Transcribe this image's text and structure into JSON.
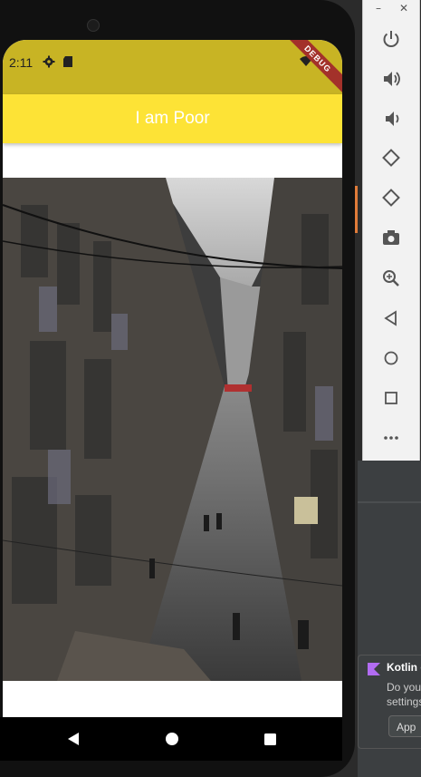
{
  "status_bar": {
    "time": "2:11"
  },
  "app_bar": {
    "title": "I am Poor"
  },
  "debug_banner": "DEBUG",
  "emulator_toolbar": {
    "buttons": [
      "power-icon",
      "volume-up-icon",
      "volume-down-icon",
      "rotate-left-icon",
      "rotate-right-icon",
      "camera-icon",
      "zoom-icon",
      "back-icon",
      "home-icon",
      "overview-icon",
      "more-icon"
    ]
  },
  "notification": {
    "title": "Kotlin c",
    "line1": "Do you",
    "line2": "settings",
    "action_label": "App"
  },
  "colors": {
    "appbar": "#fde336",
    "statusbar": "#c8b424"
  }
}
